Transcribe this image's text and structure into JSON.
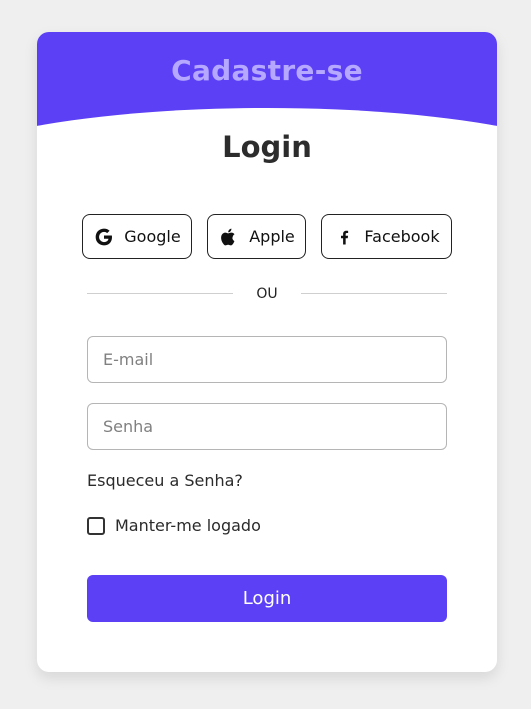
{
  "header": {
    "signup_label": "Cadastre-se"
  },
  "login": {
    "title": "Login",
    "social": [
      {
        "label": "Google",
        "icon": "google-icon"
      },
      {
        "label": "Apple",
        "icon": "apple-icon"
      },
      {
        "label": "Facebook",
        "icon": "facebook-icon"
      }
    ],
    "divider_text": "OU",
    "email_placeholder": "E-mail",
    "password_placeholder": "Senha",
    "forgot_label": "Esqueceu a Senha?",
    "remember_label": "Manter-me logado",
    "submit_label": "Login"
  },
  "colors": {
    "accent": "#5b40f5",
    "header_text": "#b6a8ff",
    "background": "#efefef"
  }
}
